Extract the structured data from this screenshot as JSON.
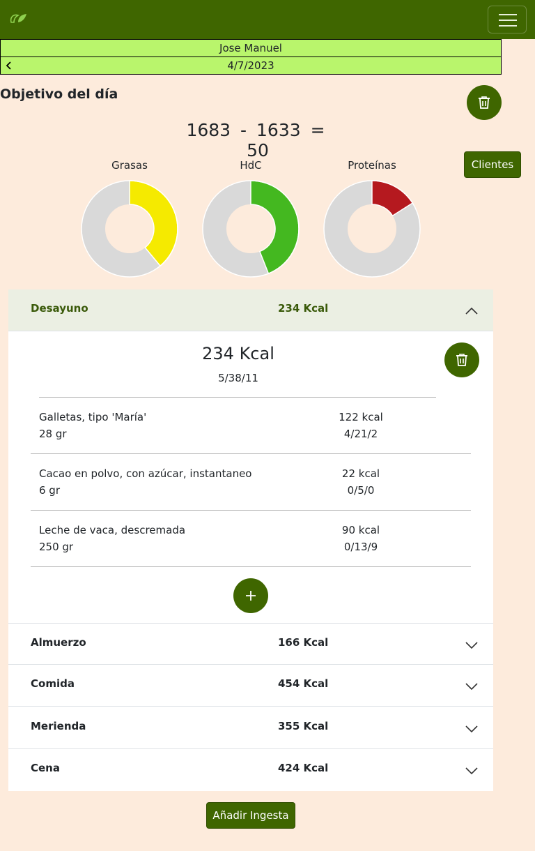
{
  "client_name": "Jose Manuel",
  "date": "4/7/2023",
  "page_title": "Objetivo del día",
  "summary": {
    "goal": "1683",
    "consumed": "1633",
    "minus": "-",
    "equals": "=",
    "result": "50"
  },
  "buttons": {
    "clientes": "Clientes",
    "add_ingesta": "Añadir Ingesta"
  },
  "macros_chart": [
    {
      "label": "Grasas",
      "fraction": 0.39,
      "color": "#f5ea00"
    },
    {
      "label": "HdC",
      "fraction": 0.44,
      "color": "#44b820"
    },
    {
      "label": "Proteínas",
      "fraction": 0.16,
      "color": "#b5191f"
    }
  ],
  "meals": [
    {
      "name": "Desayuno",
      "kcal": "234 Kcal",
      "open": true,
      "total_kcal": "234 Kcal",
      "macros": "5/38/11",
      "foods": [
        {
          "name": "Galletas, tipo 'María'",
          "amount": "28 gr",
          "kcal": "122 kcal",
          "macros": "4/21/2"
        },
        {
          "name": "Cacao en polvo, con azúcar, instantaneo",
          "amount": "6 gr",
          "kcal": "22 kcal",
          "macros": "0/5/0"
        },
        {
          "name": "Leche de vaca, descremada",
          "amount": "250 gr",
          "kcal": "90 kcal",
          "macros": "0/13/9"
        }
      ]
    },
    {
      "name": "Almuerzo",
      "kcal": "166 Kcal",
      "open": false
    },
    {
      "name": "Comida",
      "kcal": "454 Kcal",
      "open": false
    },
    {
      "name": "Merienda",
      "kcal": "355 Kcal",
      "open": false
    },
    {
      "name": "Cena",
      "kcal": "424 Kcal",
      "open": false
    }
  ],
  "colors": {
    "navbar": "#3f6600",
    "accent": "#b9f56c",
    "background": "#fdebdc",
    "donut_track": "#d9d9d9"
  },
  "icons": [
    "logo-icon",
    "menu-icon",
    "chevron-left-icon",
    "trash-icon",
    "chevron-up-icon",
    "chevron-down-icon",
    "plus-icon"
  ]
}
